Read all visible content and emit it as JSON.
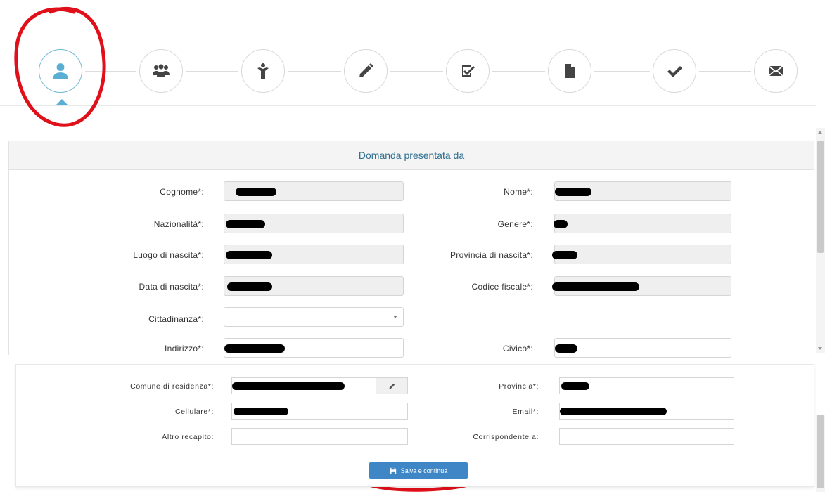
{
  "wizard": {
    "steps": [
      {
        "icon": "user-icon",
        "active": true
      },
      {
        "icon": "group-icon",
        "active": false
      },
      {
        "icon": "child-icon",
        "active": false
      },
      {
        "icon": "pencil-icon",
        "active": false
      },
      {
        "icon": "checkbox-icon",
        "active": false
      },
      {
        "icon": "document-icon",
        "active": false
      },
      {
        "icon": "checkmark-icon",
        "active": false
      },
      {
        "icon": "envelope-icon",
        "active": false
      }
    ],
    "active_color": "#5aaed3"
  },
  "panel": {
    "title": "Domanda presentata da",
    "fields": {
      "cognome": {
        "label": "Cognome*:"
      },
      "nome": {
        "label": "Nome*:"
      },
      "nazionalita": {
        "label": "Nazionalità*:"
      },
      "genere": {
        "label": "Genere*:"
      },
      "luogo_nascita": {
        "label": "Luogo di nascita*:"
      },
      "provincia_nascita": {
        "label": "Provincia di nascita*:"
      },
      "data_nascita": {
        "label": "Data di nascita*:"
      },
      "codice_fiscale": {
        "label": "Codice fiscale*:"
      },
      "cittadinanza": {
        "label": "Cittadinanza*:",
        "value": ""
      },
      "indirizzo": {
        "label": "Indirizzo*:"
      },
      "civico": {
        "label": "Civico*:"
      }
    }
  },
  "residence": {
    "comune": {
      "label": "Comune di residenza*:"
    },
    "provincia": {
      "label": "Provincia*:"
    },
    "cellulare": {
      "label": "Cellulare*:"
    },
    "email": {
      "label": "Email*:"
    },
    "altro_recapito": {
      "label": "Altro recapito:",
      "value": ""
    },
    "corrispondente": {
      "label": "Corrispondente a:",
      "value": ""
    }
  },
  "actions": {
    "save_label": "Salva e continua",
    "button_color": "#3f86c6"
  },
  "annotation_color": "#e0101a"
}
